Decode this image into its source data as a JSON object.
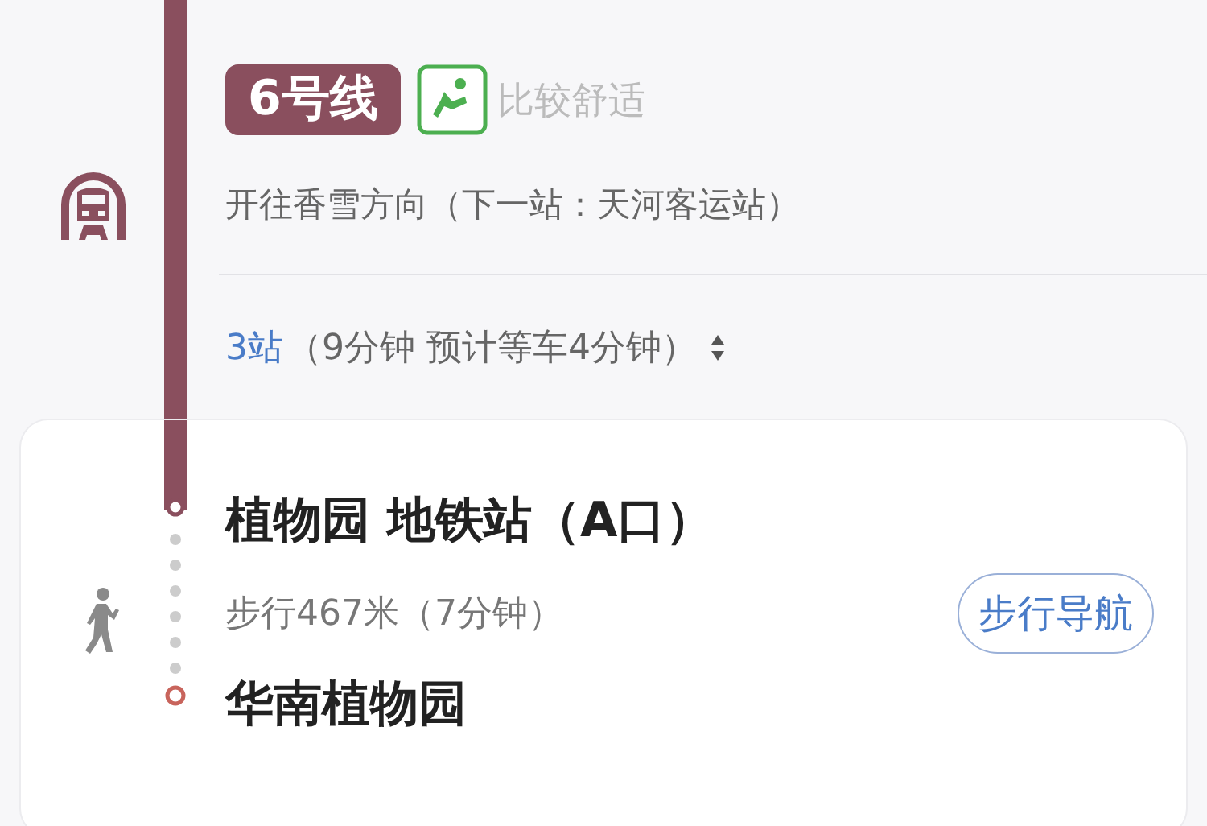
{
  "line": {
    "name": "6号线",
    "comfort": "比较舒适",
    "direction": "开往香雪方向（下一站：天河客运站）",
    "stops_count": "3站",
    "stops_detail": "（9分钟 预计等车4分钟）"
  },
  "walk": {
    "from": "植物园 地铁站（A口）",
    "info": "步行467米（7分钟）",
    "nav_button": "步行导航",
    "to": "华南植物园"
  }
}
